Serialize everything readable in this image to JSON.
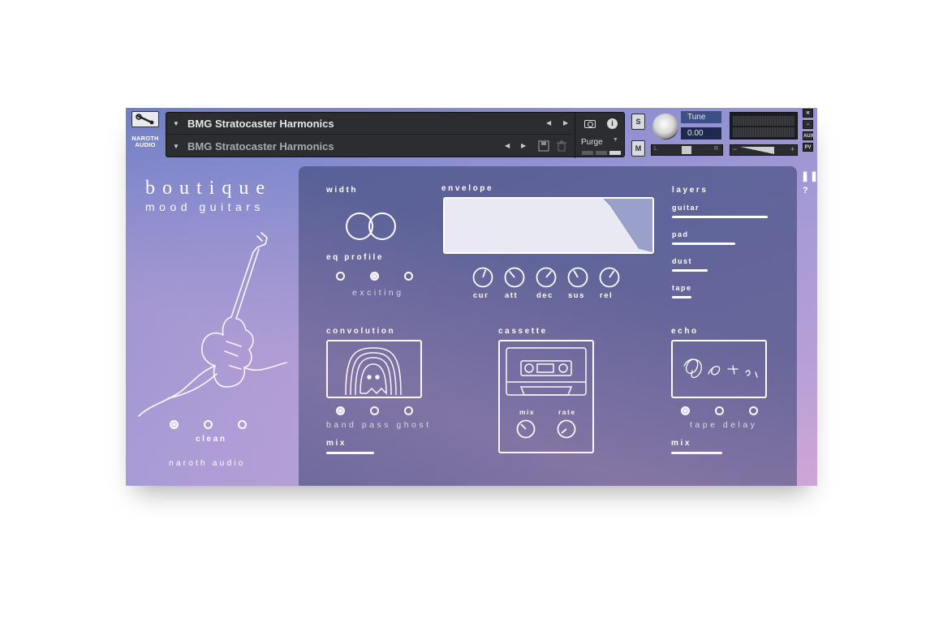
{
  "header": {
    "brand_mini": "NAROTH AUDIO",
    "instrument_name": "BMG Stratocaster Harmonics",
    "preset_name": "BMG Stratocaster Harmonics",
    "purge_label": "Purge",
    "solo_label": "S",
    "mute_label": "M",
    "tune_label": "Tune",
    "tune_value": "0.00",
    "pan_left": "L",
    "pan_right": "R",
    "vol_minus": "−",
    "vol_plus": "+",
    "side_close": "✕",
    "side_min": "−",
    "side_aux": "AUX",
    "side_pv": "PV",
    "info_glyph": "i"
  },
  "brand": {
    "title": "boutique",
    "subtitle": "mood guitars",
    "footer": "naroth audio",
    "left_mode_label": "clean",
    "left_mode_selected": 0
  },
  "width": {
    "label": "width"
  },
  "eq": {
    "label": "eq profile",
    "value": "exciting",
    "selected": 1
  },
  "envelope": {
    "label": "envelope",
    "knobs": [
      {
        "label": "cur"
      },
      {
        "label": "att"
      },
      {
        "label": "dec"
      },
      {
        "label": "sus"
      },
      {
        "label": "rel"
      }
    ]
  },
  "layers": {
    "label": "layers",
    "items": [
      {
        "label": "guitar",
        "level": 1.0
      },
      {
        "label": "pad",
        "level": 0.66
      },
      {
        "label": "dust",
        "level": 0.37
      },
      {
        "label": "tape",
        "level": 0.2
      }
    ]
  },
  "convolution": {
    "label": "convolution",
    "value": "band pass ghost",
    "selected": 0,
    "mix_label": "mix",
    "mix_level": 0.5
  },
  "cassette": {
    "label": "cassette",
    "mix_label": "mix",
    "rate_label": "rate"
  },
  "echo": {
    "label": "echo",
    "value": "tape delay",
    "selected": 0,
    "mix_label": "mix",
    "mix_level": 0.53
  },
  "right_strip": {
    "pause_glyph": "❚❚",
    "help_glyph": "?"
  },
  "colors": {
    "panel_bg": "#464e80",
    "accent_white": "#ffffff",
    "kontakt_dark": "#2b2d31"
  },
  "icons": [
    "wrench-icon",
    "camera-icon",
    "info-icon",
    "guitar-illustration",
    "ghost-illustration",
    "cassette-illustration",
    "scribble-illustration"
  ]
}
